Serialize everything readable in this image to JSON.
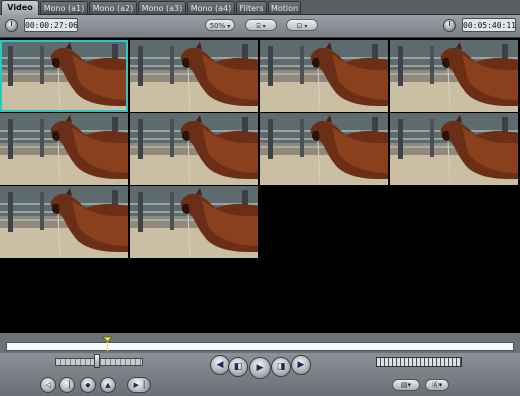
{
  "tabs": [
    {
      "label": "Video",
      "active": true
    },
    {
      "label": "Mono (a1)",
      "active": false
    },
    {
      "label": "Mono (a2)",
      "active": false
    },
    {
      "label": "Mono (a3)",
      "active": false
    },
    {
      "label": "Mono (a4)",
      "active": false
    },
    {
      "label": "Filters",
      "active": false
    },
    {
      "label": "Motion",
      "active": false
    }
  ],
  "toolbar": {
    "current_timecode": "00:00:27:06",
    "duration_timecode": "00:05:40:11",
    "zoom_label": "50%",
    "view_icon": "overlay-icon",
    "display_icon": "frame-icon"
  },
  "viewer": {
    "clip_grid_rows": 3,
    "clip_grid_columns": 4,
    "visible_clip_count": 10,
    "selected_clip_index": 0,
    "selection_color": "#27c9c0"
  },
  "transport": {
    "buttons": [
      "go-to-previous-edit",
      "play-in-to-out",
      "play",
      "play-around",
      "go-to-next-edit"
    ],
    "editing_buttons": [
      "mark-in",
      "mark-out",
      "add-marker",
      "match-frame",
      "mark-clip"
    ],
    "bottom_right_icons": [
      "generator-icon",
      "letter-a-icon"
    ]
  },
  "scrubber": {
    "playhead_position": 0.2
  },
  "colors": {
    "chrome": "#7b8086",
    "tab_active": "#c9ccd0",
    "timecode_bg": "#e4e6e8"
  }
}
